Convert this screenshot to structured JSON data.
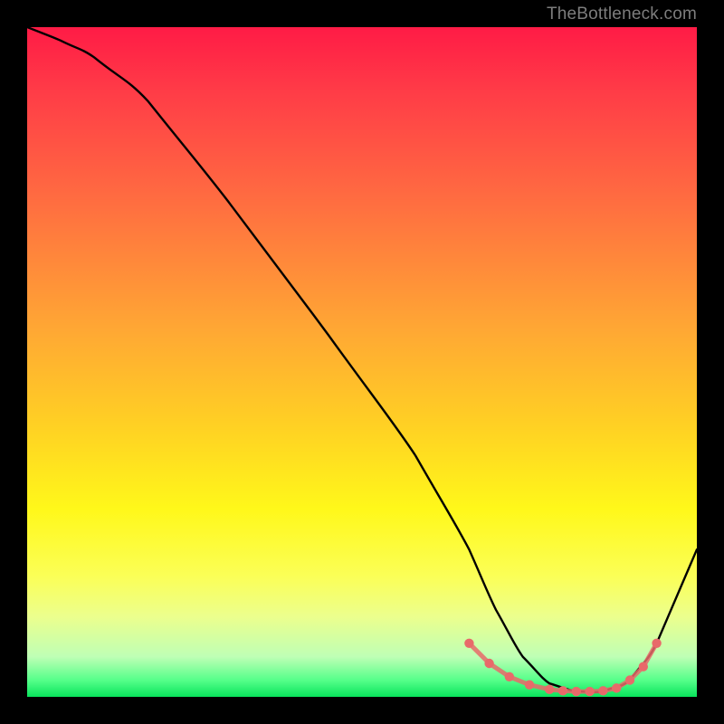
{
  "attribution": "TheBottleneck.com",
  "colors": {
    "page_bg": "#000000",
    "gradient_top": "#ff1b46",
    "gradient_mid": "#ffd223",
    "gradient_bottom": "#09e45c",
    "curve": "#000000",
    "markers": "#e86a6a"
  },
  "chart_data": {
    "type": "line",
    "title": "",
    "xlabel": "",
    "ylabel": "",
    "xlim": [
      0,
      100
    ],
    "ylim": [
      0,
      100
    ],
    "series": [
      {
        "name": "bottleneck-curve",
        "x": [
          0,
          5,
          10,
          18,
          30,
          45,
          58,
          66,
          70,
          74,
          78,
          82,
          86,
          90,
          94,
          100
        ],
        "y": [
          100,
          98,
          95.5,
          89,
          74,
          54,
          36,
          22,
          13,
          6,
          2,
          0.8,
          0.8,
          2.5,
          8,
          22
        ]
      }
    ],
    "markers": {
      "name": "highlight-points",
      "x": [
        66,
        69,
        72,
        75,
        78,
        80,
        82,
        84,
        86,
        88,
        90,
        92,
        94
      ],
      "y": [
        8,
        5,
        3,
        1.8,
        1.1,
        0.9,
        0.8,
        0.8,
        0.9,
        1.3,
        2.5,
        4.5,
        8
      ]
    }
  }
}
